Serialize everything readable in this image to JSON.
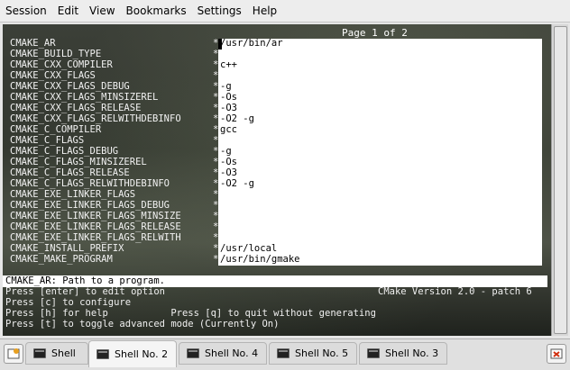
{
  "menubar": {
    "items": [
      "Session",
      "Edit",
      "View",
      "Bookmarks",
      "Settings",
      "Help"
    ]
  },
  "terminal": {
    "page_indicator": "Page 1 of 2",
    "variables": [
      {
        "name": "CMAKE_AR",
        "value": "/usr/bin/ar"
      },
      {
        "name": "CMAKE_BUILD_TYPE",
        "value": ""
      },
      {
        "name": "CMAKE_CXX_COMPILER",
        "value": "c++"
      },
      {
        "name": "CMAKE_CXX_FLAGS",
        "value": ""
      },
      {
        "name": "CMAKE_CXX_FLAGS_DEBUG",
        "value": "-g"
      },
      {
        "name": "CMAKE_CXX_FLAGS_MINSIZEREL",
        "value": "-Os"
      },
      {
        "name": "CMAKE_CXX_FLAGS_RELEASE",
        "value": "-O3"
      },
      {
        "name": "CMAKE_CXX_FLAGS_RELWITHDEBINFO",
        "value": "-O2 -g"
      },
      {
        "name": "CMAKE_C_COMPILER",
        "value": "gcc"
      },
      {
        "name": "CMAKE_C_FLAGS",
        "value": ""
      },
      {
        "name": "CMAKE_C_FLAGS_DEBUG",
        "value": "-g"
      },
      {
        "name": "CMAKE_C_FLAGS_MINSIZEREL",
        "value": "-Os"
      },
      {
        "name": "CMAKE_C_FLAGS_RELEASE",
        "value": "-O3"
      },
      {
        "name": "CMAKE_C_FLAGS_RELWITHDEBINFO",
        "value": "-O2 -g"
      },
      {
        "name": "CMAKE_EXE_LINKER_FLAGS",
        "value": ""
      },
      {
        "name": "CMAKE_EXE_LINKER_FLAGS_DEBUG",
        "value": ""
      },
      {
        "name": "CMAKE_EXE_LINKER_FLAGS_MINSIZE",
        "value": ""
      },
      {
        "name": "CMAKE_EXE_LINKER_FLAGS_RELEASE",
        "value": ""
      },
      {
        "name": "CMAKE_EXE_LINKER_FLAGS_RELWITH",
        "value": ""
      },
      {
        "name": "CMAKE_INSTALL_PREFIX",
        "value": "/usr/local"
      },
      {
        "name": "CMAKE_MAKE_PROGRAM",
        "value": "/usr/bin/gmake"
      }
    ],
    "marker": "*",
    "status": "CMAKE_AR: Path to a program.",
    "help_lines": [
      "Press [enter] to edit option",
      "Press [c] to configure",
      "Press [h] for help           Press [q] to quit without generating",
      "Press [t] to toggle advanced mode (Currently On)"
    ],
    "version": "CMake Version 2.0 - patch 6"
  },
  "tabs": [
    {
      "label": "Shell",
      "active": false
    },
    {
      "label": "Shell No. 2",
      "active": true
    },
    {
      "label": "Shell No. 4",
      "active": false
    },
    {
      "label": "Shell No. 5",
      "active": false
    },
    {
      "label": "Shell No. 3",
      "active": false
    }
  ],
  "icons": {
    "new_tab": "new-tab-icon",
    "close_tab": "close-tab-icon"
  },
  "colors": {
    "value_bg": "#ffffff",
    "terminal_fg": "#f0f0f0",
    "close_red": "#d03010"
  }
}
